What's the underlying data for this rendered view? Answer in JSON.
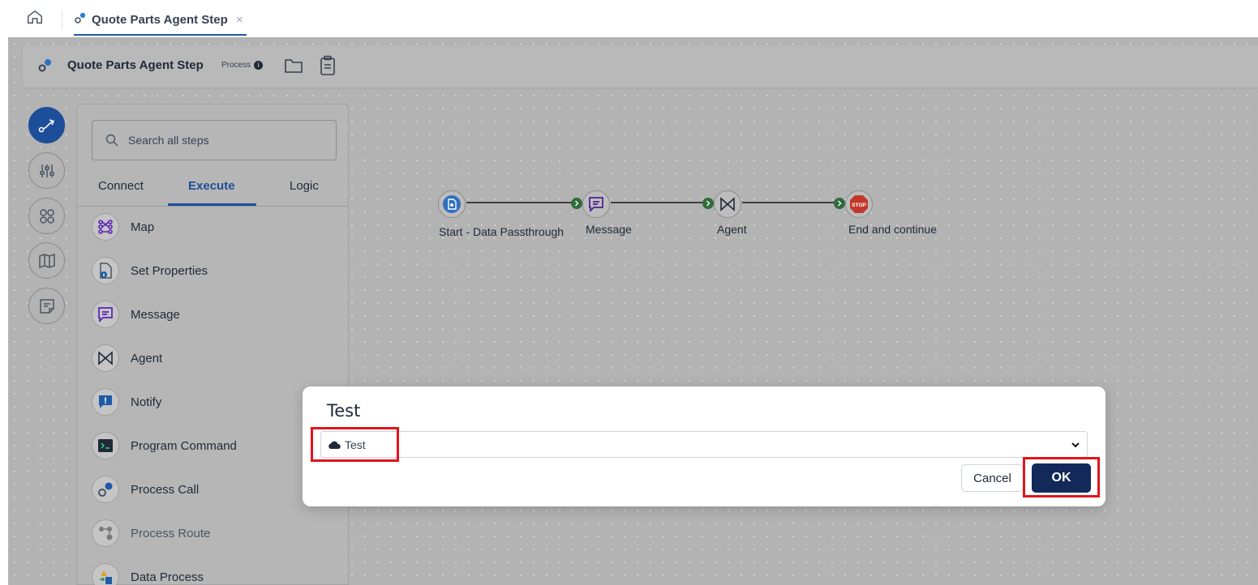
{
  "tabbar": {
    "home_icon": "home-icon",
    "tab_label": "Quote Parts Agent Step",
    "tab_close": "×"
  },
  "process": {
    "title": "Quote Parts Agent Step",
    "badge": "Process",
    "info": "i"
  },
  "rail": [
    "route-icon",
    "sliders-icon",
    "circles-icon",
    "map-icon",
    "notes-icon"
  ],
  "panel": {
    "search_placeholder": "Search all steps",
    "tabs": [
      "Connect",
      "Execute",
      "Logic"
    ],
    "active_tab": "Execute",
    "steps": [
      {
        "label": "Map"
      },
      {
        "label": "Set Properties"
      },
      {
        "label": "Message"
      },
      {
        "label": "Agent"
      },
      {
        "label": "Notify"
      },
      {
        "label": "Program Command"
      },
      {
        "label": "Process Call"
      },
      {
        "label": "Process Route"
      },
      {
        "label": "Data Process"
      }
    ]
  },
  "flow": {
    "nodes": [
      {
        "label": "Start - Data Passthrough"
      },
      {
        "label": "Message"
      },
      {
        "label": "Agent"
      },
      {
        "label": "End and continue"
      }
    ],
    "stop_text": "STOP"
  },
  "modal": {
    "title": "Test",
    "selected": "Test",
    "cancel": "Cancel",
    "ok": "OK"
  },
  "colors": {
    "accent": "#1e4f9a",
    "ok_button": "#13295a",
    "highlight": "#e3141c",
    "connector": "#2f6b3b"
  }
}
